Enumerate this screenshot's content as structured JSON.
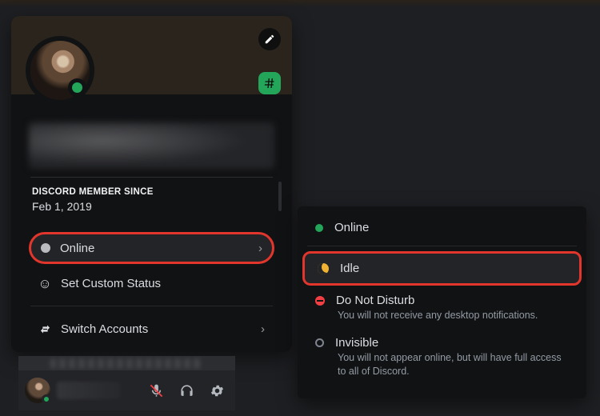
{
  "profile": {
    "member_since_title": "DISCORD MEMBER SINCE",
    "member_since_date": "Feb 1, 2019"
  },
  "menu": {
    "online_label": "Online",
    "set_custom_status_label": "Set Custom Status",
    "switch_accounts_label": "Switch Accounts"
  },
  "status_options": {
    "online": {
      "label": "Online"
    },
    "idle": {
      "label": "Idle"
    },
    "dnd": {
      "label": "Do Not Disturb",
      "description": "You will not receive any desktop notifications."
    },
    "invisible": {
      "label": "Invisible",
      "description": "You will not appear online, but will have full access to all of Discord."
    }
  },
  "icons": {
    "edit": "pencil-icon",
    "hash": "hashtag-icon",
    "chevron": "›"
  }
}
